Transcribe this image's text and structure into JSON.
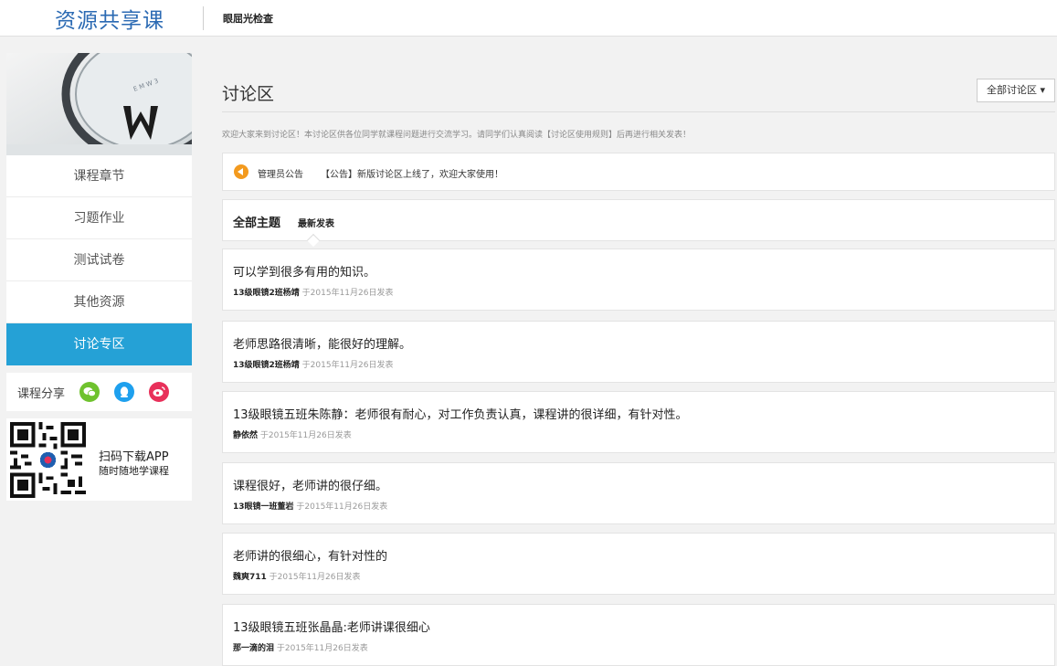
{
  "header": {
    "logo": "资源共享课",
    "course_title": "眼屈光检查"
  },
  "sidebar": {
    "nav": [
      {
        "label": "课程章节",
        "active": false
      },
      {
        "label": "习题作业",
        "active": false
      },
      {
        "label": "测试试卷",
        "active": false
      },
      {
        "label": "其他资源",
        "active": false
      },
      {
        "label": "讨论专区",
        "active": true
      }
    ],
    "share_label": "课程分享",
    "share_icons": [
      "wechat-icon",
      "qq-icon",
      "weibo-icon"
    ],
    "app": {
      "line1": "扫码下载APP",
      "line2": "随时随地学课程"
    }
  },
  "main": {
    "title": "讨论区",
    "filter_label": "全部讨论区 ▾",
    "welcome": "欢迎大家来到讨论区！本讨论区供各位同学就课程问题进行交流学习。请同学们认真阅读【讨论区使用规则】后再进行相关发表！",
    "notice": {
      "label": "管理员公告",
      "text": "【公告】新版讨论区上线了，欢迎大家使用！"
    },
    "tabs": {
      "all": "全部主题",
      "latest": "最新发表"
    },
    "posts": [
      {
        "title": "可以学到很多有用的知识。",
        "author": "13级眼镜2班杨靖",
        "date": "于2015年11月26日发表"
      },
      {
        "title": "老师思路很清晰，能很好的理解。",
        "author": "13级眼镜2班杨靖",
        "date": "于2015年11月26日发表"
      },
      {
        "title": "13级眼镜五班朱陈静：老师很有耐心，对工作负责认真，课程讲的很详细，有针对性。",
        "author": "静依然",
        "date": "于2015年11月26日发表"
      },
      {
        "title": "课程很好，老师讲的很仔细。",
        "author": "13眼镜一班董岩",
        "date": "于2015年11月26日发表"
      },
      {
        "title": "老师讲的很细心，有针对性的",
        "author": "魏爽711",
        "date": "于2015年11月26日发表"
      },
      {
        "title": "13级眼镜五班张晶晶:老师讲课很细心",
        "author": "那一滴的泪",
        "date": "于2015年11月26日发表"
      }
    ]
  },
  "colors": {
    "accent": "#25a1d6",
    "logo": "#2b6ab3",
    "notice_icon": "#f39a1e",
    "wechat": "#6fc22e",
    "qq": "#1ea0ee",
    "weibo": "#e8305a"
  }
}
